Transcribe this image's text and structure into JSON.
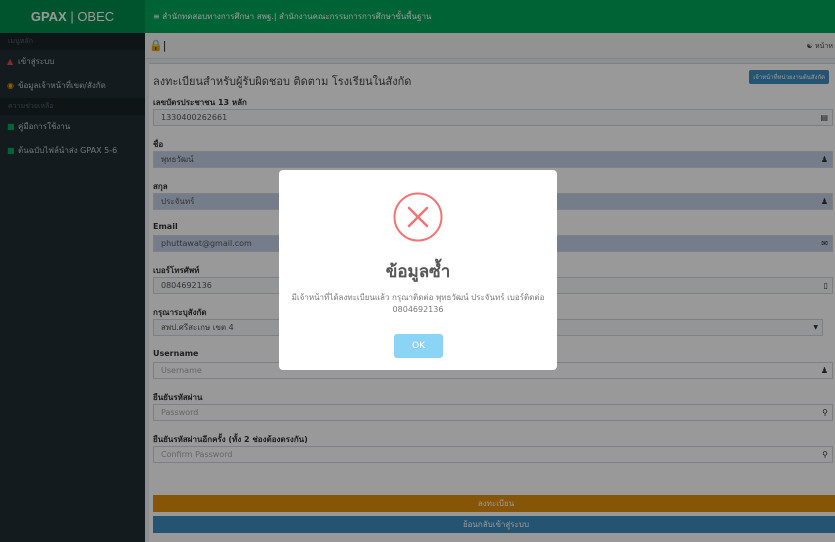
{
  "topbar": {
    "brand_bold": "GPAX",
    "brand_rest": " | OBEC",
    "title": "≡ สำนักทดสอบทางการศึกษา สพฐ.| สำนักงานคณะกรรมการการศึกษาขั้นพื้นฐาน"
  },
  "sidebar": {
    "header1": "เมนูหลัก",
    "item_login": "เข้าสู่ระบบ",
    "item_staff": "ข้อมูลเจ้าหน้าที่เขต/สังกัด",
    "header2": "ความช่วยเหลือ",
    "item_manual": "คู่มือการใช้งาน",
    "item_template": "ต้นฉบับไฟล์นำส่ง GPAX 5-6"
  },
  "header": {
    "right_text": "หน้าห"
  },
  "form": {
    "title": "ลงทะเบียนสำหรับผู้รับผิดชอบ ติดตาม โรงเรียนในสังกัด",
    "badge": "เจ้าหน้าที่หน่วยงานต้นสังกัด",
    "id_label": "เลขบัตรประชาชน 13 หลัก",
    "id_value": "1330400262661",
    "fname_label": "ชื่อ",
    "fname_value": "พุทธวัฒน์",
    "lname_label": "สกุล",
    "lname_value": "ประจันทร์",
    "email_label": "Email",
    "email_value": "phuttawat@gmail.com",
    "phone_label": "เบอร์โทรศัพท์",
    "phone_value": "0804692136",
    "org_label": "กรุณาระบุสังกัด",
    "org_value": "สพป.ศรีสะเกษ เขต 4",
    "username_label": "Username",
    "username_placeholder": "Username",
    "password_label": "ยืนยันรหัสผ่าน",
    "password_placeholder": "Password",
    "confirm_label": "ยืนยันรหัสผ่านอีกครั้ง (ทั้ง 2 ช่องต้องตรงกัน)",
    "confirm_placeholder": "Confirm Password",
    "register_btn": "ลงทะเบียน",
    "back_btn": "ย้อนกลับเข้าสู่ระบบ"
  },
  "modal": {
    "title": "ข้อมูลซ้ำ",
    "message": "มีเจ้าหน้าที่ได้ลงทะเบียนแล้ว กรุณาติดต่อ พุทธวัฒน์ ประจันทร์ เบอร์ติดต่อ 0804692136",
    "ok": "OK",
    "icon": "error-x-icon",
    "icon_color": "#f27474"
  }
}
